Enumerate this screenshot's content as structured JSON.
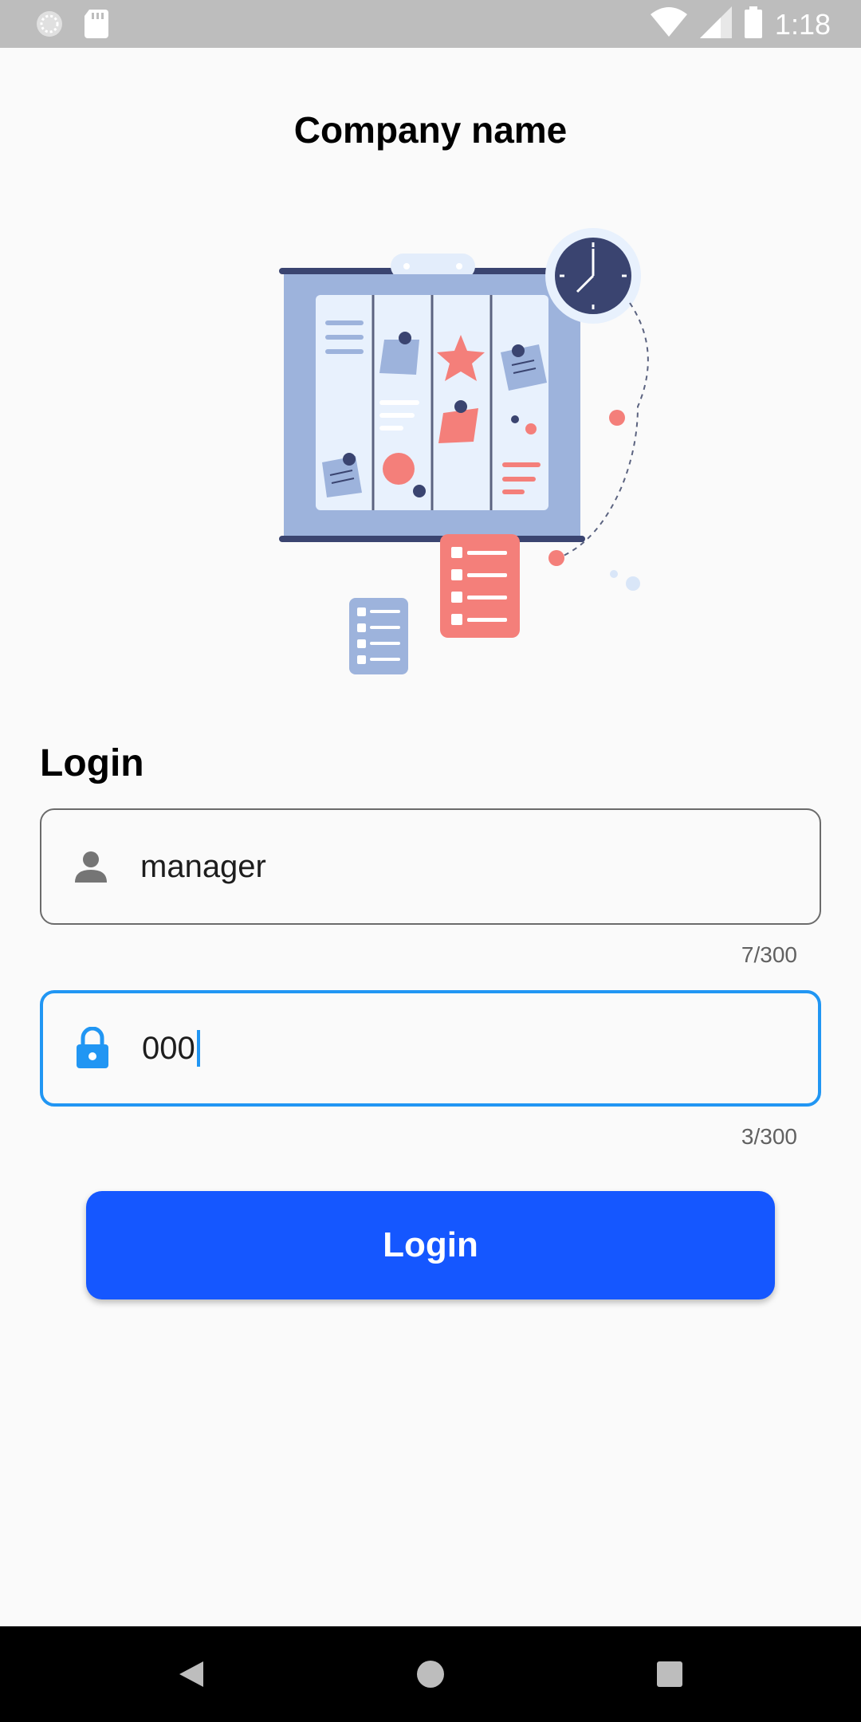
{
  "status_bar": {
    "time": "1:18",
    "icons": [
      "notification-dot-icon",
      "sd-card-icon",
      "wifi-icon",
      "signal-icon",
      "battery-icon"
    ]
  },
  "header": {
    "title": "Company name"
  },
  "login_form": {
    "section_title": "Login",
    "username": {
      "icon": "person-icon",
      "value": "manager",
      "counter": "7/300"
    },
    "password": {
      "icon": "lock-icon",
      "value": "000",
      "counter": "3/300"
    },
    "submit_label": "Login"
  },
  "nav_bar": {
    "buttons": [
      "back-icon",
      "home-icon",
      "recents-icon"
    ]
  },
  "colors": {
    "accent": "#1557ff",
    "focus": "#2196f3",
    "background": "#fafafa",
    "illustration_blue": "#9db3dc",
    "illustration_coral": "#f47f7a",
    "illustration_navy": "#3a4470"
  }
}
